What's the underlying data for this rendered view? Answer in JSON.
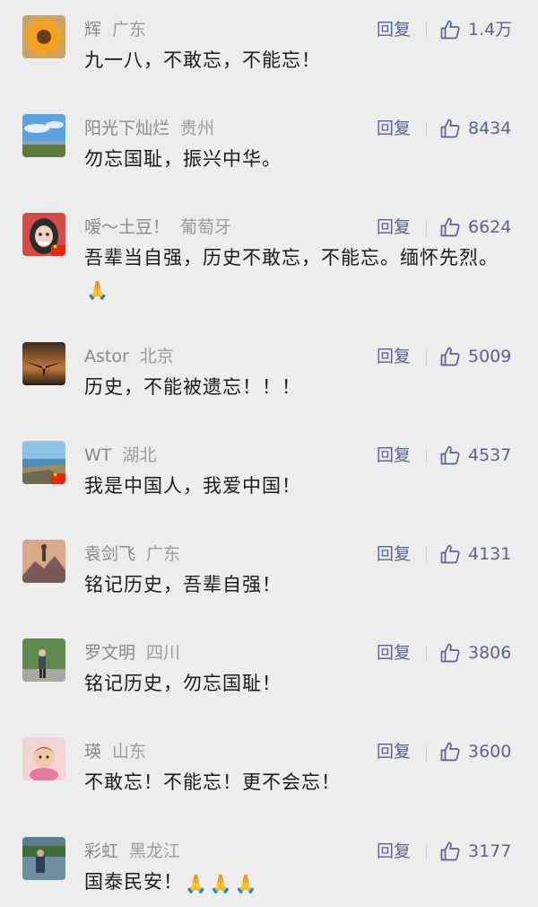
{
  "reply_label": "回复",
  "pray_emoji": "🙏",
  "comments": [
    {
      "name": "辉",
      "region": "广东",
      "likes": "1.4万",
      "text": "九一八，不敢忘，不能忘！",
      "avatar": "sunflower"
    },
    {
      "name": "阳光下灿烂",
      "region": "贵州",
      "likes": "8434",
      "text": "勿忘国耻，振兴中华。",
      "avatar": "sky-landscape"
    },
    {
      "name": "嗳～土豆！",
      "region": "葡萄牙",
      "likes": "6624",
      "text": "吾辈当自强，历史不敢忘，不能忘。缅怀先烈。🙏",
      "avatar": "girl-portrait"
    },
    {
      "name": "Astor",
      "region": "北京",
      "likes": "5009",
      "text": "历史，不能被遗忘！！！",
      "avatar": "eagle-silhouette"
    },
    {
      "name": "WT",
      "region": "湖北",
      "likes": "4537",
      "text": "我是中国人，我爱中国！",
      "avatar": "coastline"
    },
    {
      "name": "袁剑飞",
      "region": "广东",
      "likes": "4131",
      "text": "铭记历史，吾辈自强！",
      "avatar": "mountain-statue"
    },
    {
      "name": "罗文明",
      "region": "四川",
      "likes": "3806",
      "text": "铭记历史，勿忘国耻！",
      "avatar": "person-in-park"
    },
    {
      "name": "瑛",
      "region": "山东",
      "likes": "3600",
      "text": "不敢忘！不能忘！更不会忘！",
      "avatar": "baby-portrait"
    },
    {
      "name": "彩虹",
      "region": "黑龙江",
      "likes": "3177",
      "text": "国泰民安！🙏🙏🙏",
      "avatar": "person-by-lake"
    }
  ]
}
